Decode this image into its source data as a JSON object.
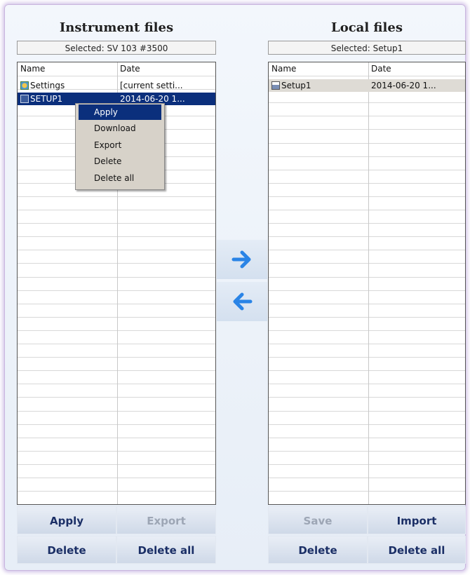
{
  "instrument": {
    "title": "Instrument files",
    "selected": "Selected: SV 103 #3500",
    "col_name": "Name",
    "col_date": "Date",
    "rows": [
      {
        "name": "Settings",
        "date": "[current setti...",
        "icon": "settings-file-icon"
      },
      {
        "name": "SETUP1",
        "date": "2014-06-20 1...",
        "icon": "setup-file-icon"
      }
    ],
    "buttons": {
      "apply": "Apply",
      "export": "Export",
      "delete": "Delete",
      "delete_all": "Delete all"
    }
  },
  "local": {
    "title": "Local files",
    "selected": "Selected: Setup1",
    "col_name": "Name",
    "col_date": "Date",
    "rows": [
      {
        "name": "Setup1",
        "date": "2014-06-20 1...",
        "icon": "setup-file-icon"
      }
    ],
    "buttons": {
      "save": "Save",
      "import": "Import",
      "delete": "Delete",
      "delete_all": "Delete all"
    }
  },
  "transfer": {
    "right_icon": "arrow-right-icon",
    "left_icon": "arrow-left-icon"
  },
  "context_menu": {
    "items": [
      "Apply",
      "Download",
      "Export",
      "Delete",
      "Delete all"
    ],
    "highlighted": "Apply"
  },
  "colors": {
    "selection": "#0b2f7c",
    "accent_arrow": "#2a84e6",
    "button_text": "#1b2f66",
    "disabled_text": "#9da6b5",
    "context_menu_bg": "#d7d2c9"
  }
}
